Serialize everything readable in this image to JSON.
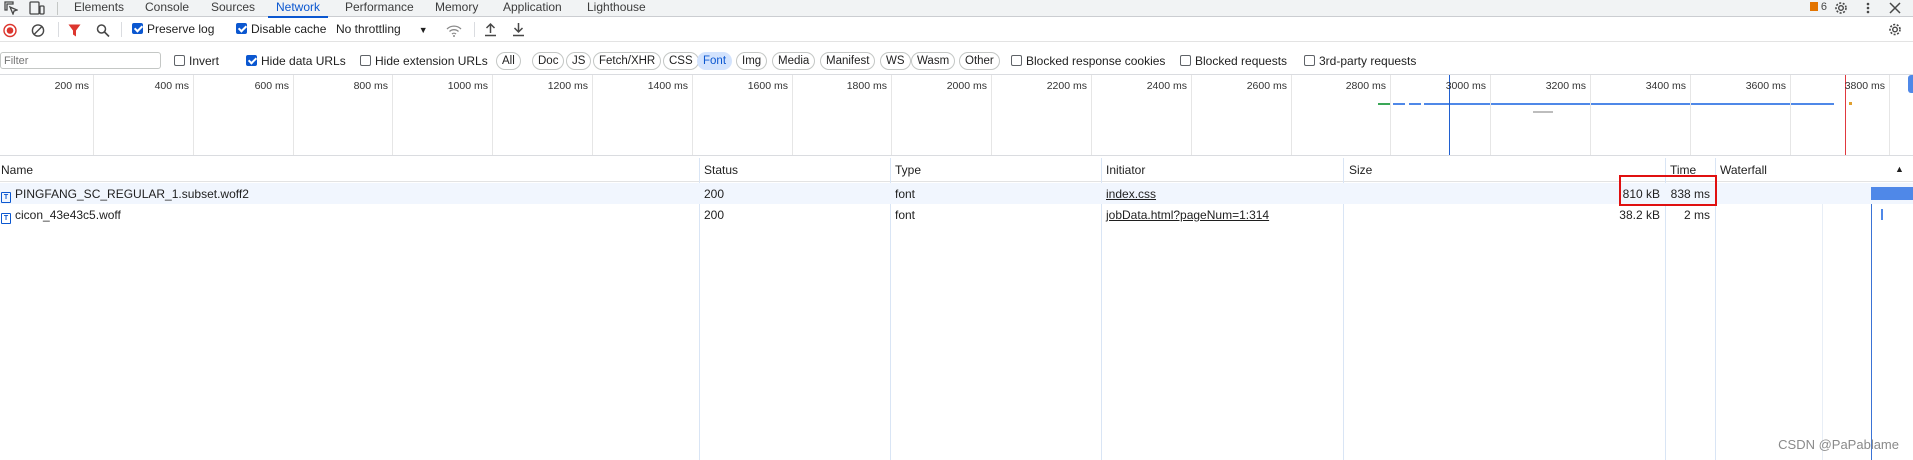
{
  "tabs": [
    "Elements",
    "Console",
    "Sources",
    "Network",
    "Performance",
    "Memory",
    "Application",
    "Lighthouse"
  ],
  "issues_count": "6",
  "toolbar": {
    "preserve_log": "Preserve log",
    "disable_cache": "Disable cache",
    "throttling": "No throttling"
  },
  "filters": {
    "placeholder": "Filter",
    "invert": "Invert",
    "hide_data_urls": "Hide data URLs",
    "hide_extension_urls": "Hide extension URLs",
    "types": [
      "All",
      "Doc",
      "JS",
      "Fetch/XHR",
      "CSS",
      "Font",
      "Img",
      "Media",
      "Manifest",
      "WS",
      "Wasm",
      "Other"
    ],
    "selected_type": "Font",
    "blocked_cookies": "Blocked response cookies",
    "blocked_requests": "Blocked requests",
    "third_party": "3rd-party requests"
  },
  "timeline": {
    "ticks": [
      "200 ms",
      "400 ms",
      "600 ms",
      "800 ms",
      "1000 ms",
      "1200 ms",
      "1400 ms",
      "1600 ms",
      "1800 ms",
      "2000 ms",
      "2200 ms",
      "2400 ms",
      "2600 ms",
      "2800 ms",
      "3000 ms",
      "3200 ms",
      "3400 ms",
      "3600 ms",
      "3800 ms"
    ]
  },
  "table": {
    "headers": {
      "name": "Name",
      "status": "Status",
      "type": "Type",
      "initiator": "Initiator",
      "size": "Size",
      "time": "Time",
      "waterfall": "Waterfall"
    },
    "rows": [
      {
        "name": "PINGFANG_SC_REGULAR_1.subset.woff2",
        "status": "200",
        "type": "font",
        "initiator": "index.css",
        "size": "810 kB",
        "time": "838 ms"
      },
      {
        "name": "cicon_43e43c5.woff",
        "status": "200",
        "type": "font",
        "initiator": "jobData.html?pageNum=1:314",
        "size": "38.2 kB",
        "time": "2 ms"
      }
    ]
  },
  "watermark": "CSDN @PaPablame"
}
